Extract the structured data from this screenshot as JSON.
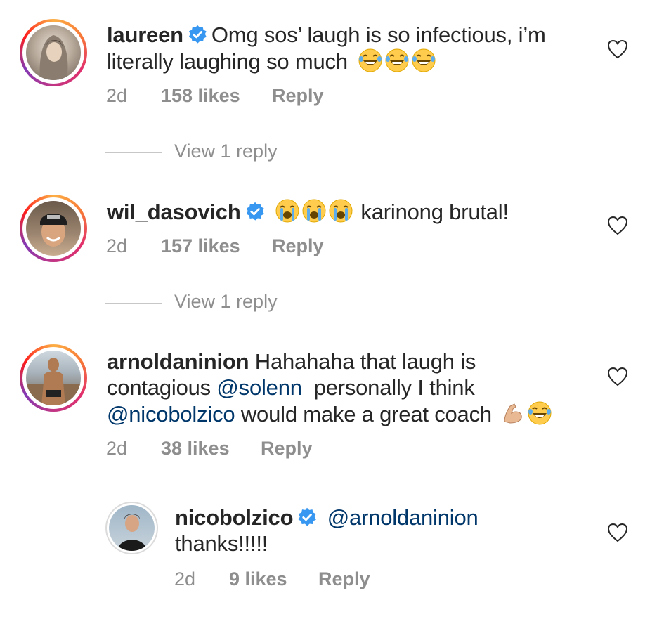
{
  "comments": [
    {
      "username": "laureen",
      "verified": true,
      "text_line1": "Omg sos’ laugh is so infectious, i’m",
      "text_line2": "literally laughing so much",
      "emojis": [
        "face-with-tears-of-joy",
        "face-with-tears-of-joy",
        "face-with-tears-of-joy"
      ],
      "time": "2d",
      "likes": "158 likes",
      "reply_label": "Reply",
      "view_replies": "View 1 reply"
    },
    {
      "username": "wil_dasovich",
      "verified": true,
      "emojis": [
        "loudly-crying-face",
        "loudly-crying-face",
        "loudly-crying-face"
      ],
      "text": "karinong brutal!",
      "time": "2d",
      "likes": "157 likes",
      "reply_label": "Reply",
      "view_replies": "View 1 reply"
    },
    {
      "username": "arnoldaninion",
      "verified": false,
      "text_line1": "Hahahaha that laugh is",
      "text_line2_pre": "contagious",
      "mention1": "@solenn",
      "text_line2_post": "personally I think",
      "mention2": "@nicobolzico",
      "text_line3": "would make a great coach",
      "emojis": [
        "flexed-biceps",
        "face-with-tears-of-joy"
      ],
      "time": "2d",
      "likes": "38 likes",
      "reply_label": "Reply"
    },
    {
      "username": "nicobolzico",
      "verified": true,
      "mention": "@arnoldaninion",
      "text": "thanks!!!!!",
      "time": "2d",
      "likes": "9 likes",
      "reply_label": "Reply"
    }
  ],
  "colors": {
    "text": "#262626",
    "secondary": "#8e8e8e",
    "mention": "#00376b",
    "verified": "#3897f0"
  },
  "icons": {
    "like": "heart-outline-icon",
    "verified": "verified-badge-icon"
  }
}
